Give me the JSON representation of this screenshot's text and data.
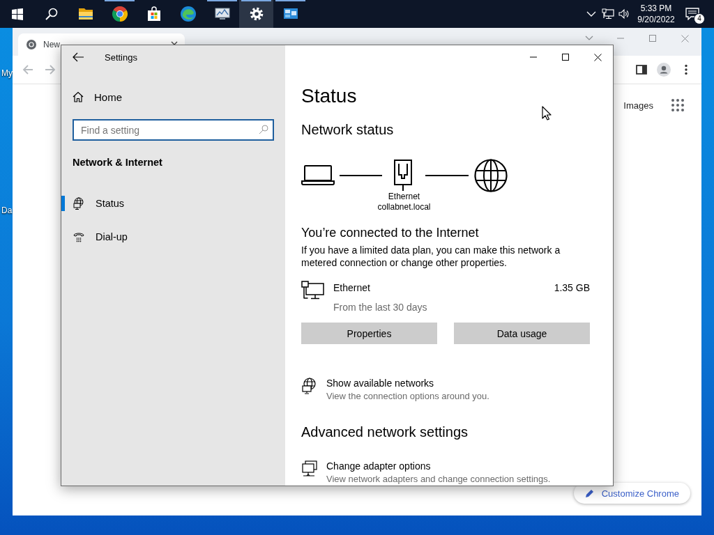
{
  "taskbar": {
    "apps": [
      {
        "kind": "start",
        "running": false,
        "selected": false
      },
      {
        "kind": "search",
        "running": false,
        "selected": false
      },
      {
        "kind": "explorer",
        "running": false,
        "selected": false
      },
      {
        "kind": "chrome",
        "running": true,
        "selected": false
      },
      {
        "kind": "store",
        "running": false,
        "selected": false
      },
      {
        "kind": "edge",
        "running": false,
        "selected": false
      },
      {
        "kind": "monitor",
        "running": true,
        "selected": false
      },
      {
        "kind": "settings",
        "running": true,
        "selected": true
      },
      {
        "kind": "remote",
        "running": true,
        "selected": false
      }
    ],
    "clock": {
      "time": "5:33 PM",
      "date": "9/20/2022"
    },
    "notifications": "4"
  },
  "desktop": {
    "icon_labels": [
      "My",
      "Da"
    ]
  },
  "chrome": {
    "tab": {
      "title": "New"
    },
    "links": [
      "Images"
    ],
    "customize_button": "Customize Chrome"
  },
  "settings": {
    "title": "Settings",
    "home": "Home",
    "search": {
      "placeholder": "Find a setting"
    },
    "section": "Network & Internet",
    "nav": [
      {
        "label": "Status",
        "kind": "globe",
        "selected": true
      },
      {
        "label": "Dial-up",
        "kind": "phone",
        "selected": false
      }
    ],
    "page_title": "Status",
    "network_status": {
      "heading": "Network status",
      "adapter": "Ethernet",
      "domain": "collabnet.local"
    },
    "connection": {
      "heading": "You’re connected to the Internet",
      "description": "If you have a limited data plan, you can make this network a metered connection or change other properties."
    },
    "usage": {
      "name": "Ethernet",
      "period": "From the last 30 days",
      "amount": "1.35 GB"
    },
    "buttons": [
      "Properties",
      "Data usage"
    ],
    "links": [
      {
        "kind": "globe",
        "title": "Show available networks",
        "subtitle": "View the connection options around you."
      }
    ],
    "advanced": {
      "heading": "Advanced network settings",
      "links": [
        {
          "kind": "adapter",
          "title": "Change adapter options",
          "subtitle": "View network adapters and change connection settings."
        }
      ]
    }
  }
}
